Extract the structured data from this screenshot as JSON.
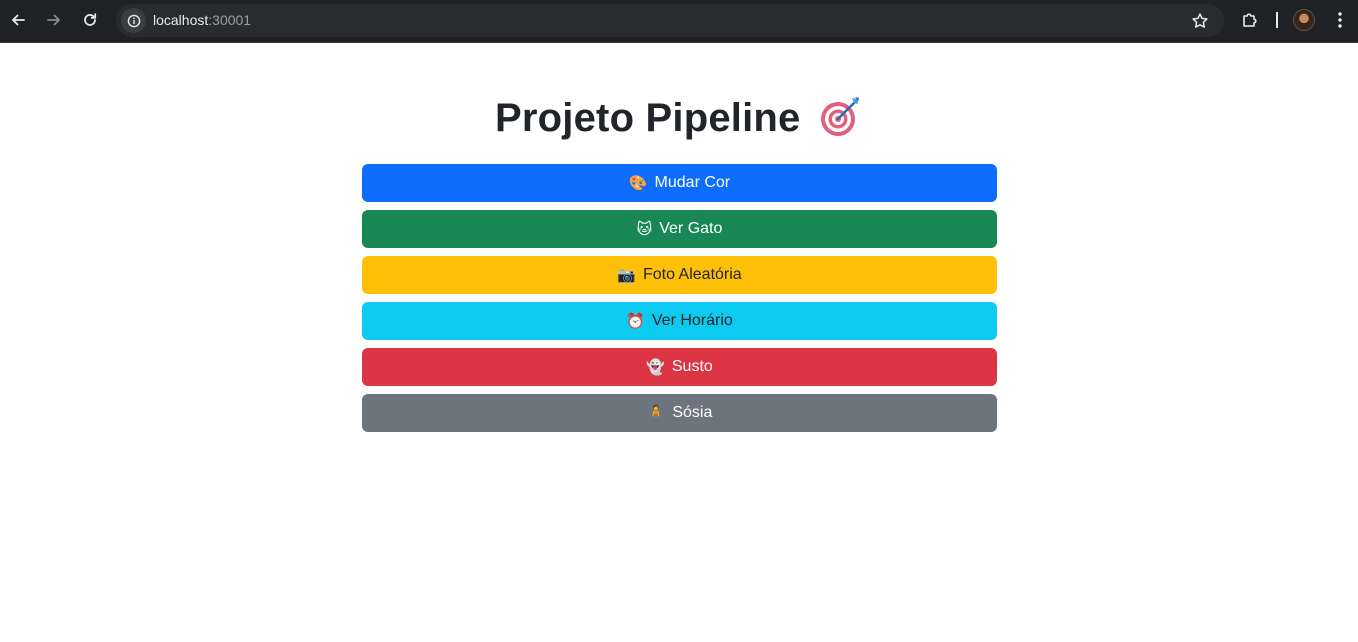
{
  "browser": {
    "url_host": "localhost",
    "url_port": ":30001"
  },
  "page": {
    "title": "Projeto Pipeline",
    "title_icon": "dart-target-icon"
  },
  "buttons": [
    {
      "label": "Mudar Cor",
      "emoji": "🎨",
      "icon": "palette-icon",
      "color": "#0d6efd",
      "text_color": "#ffffff"
    },
    {
      "label": "Ver Gato",
      "emoji": "🐱",
      "icon": "cat-icon",
      "color": "#198754",
      "text_color": "#ffffff"
    },
    {
      "label": "Foto Aleatória",
      "emoji": "📷",
      "icon": "camera-icon",
      "color": "#ffc107",
      "text_color": "#212529"
    },
    {
      "label": "Ver Horário",
      "emoji": "⏰",
      "icon": "alarm-clock-icon",
      "color": "#0dcaf0",
      "text_color": "#212529"
    },
    {
      "label": "Susto",
      "emoji": "👻",
      "icon": "ghost-icon",
      "color": "#dc3545",
      "text_color": "#ffffff"
    },
    {
      "label": "Sósia",
      "emoji": "🧍",
      "icon": "person-standing-icon",
      "color": "#6c757d",
      "text_color": "#ffffff"
    }
  ]
}
